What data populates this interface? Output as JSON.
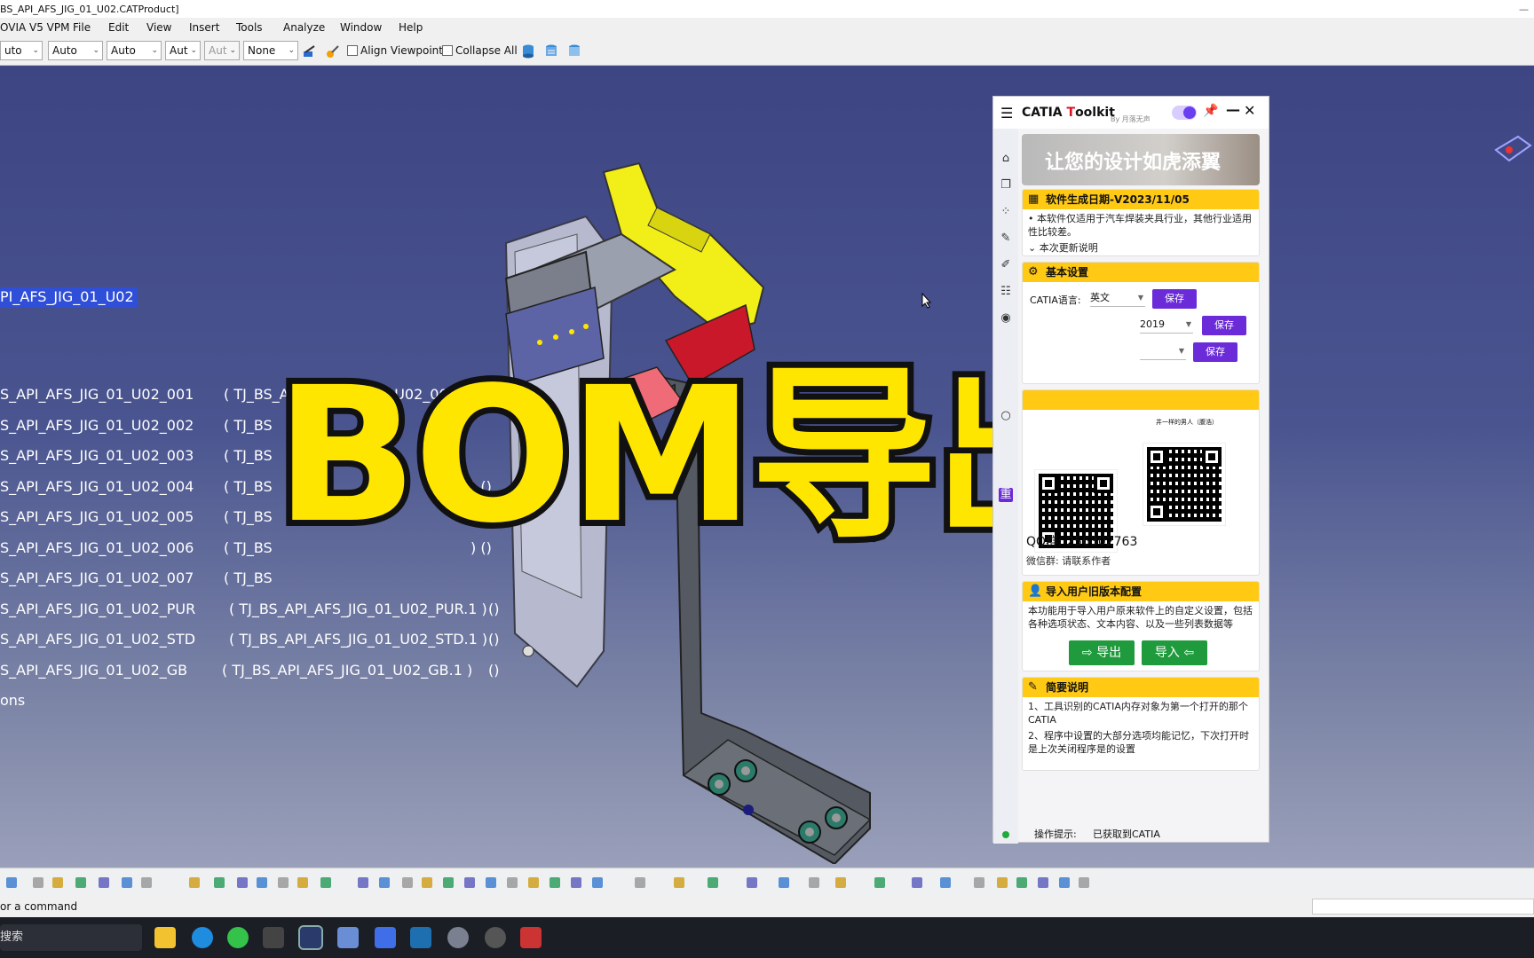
{
  "window": {
    "title": "BS_API_AFS_JIG_01_U02.CATProduct]"
  },
  "menu": {
    "app": "OVIA V5 VPM",
    "items": [
      "File",
      "Edit",
      "View",
      "Insert",
      "Tools",
      "Analyze",
      "Window",
      "Help"
    ]
  },
  "toolbar": {
    "combos": [
      "uto",
      "Auto",
      "Auto",
      "Aut",
      "Aut",
      "None"
    ],
    "align_viewpoint": "Align Viewpoint",
    "collapse_all": "Collapse All"
  },
  "tree": {
    "root": "PI_AFS_JIG_01_U02",
    "rows": [
      {
        "name": "S_API_AFS_JIG_01_U02_001",
        "instance": "( TJ_BS_API_AFS_JIG_01_U02_001.1 )",
        "extra": "()"
      },
      {
        "name": "S_API_AFS_JIG_01_U02_002",
        "instance": "( TJ_BS",
        "extra": ""
      },
      {
        "name": "S_API_AFS_JIG_01_U02_003",
        "instance": "( TJ_BS",
        "extra": ""
      },
      {
        "name": "S_API_AFS_JIG_01_U02_004",
        "instance": "( TJ_BS",
        "extra": ")  ()"
      },
      {
        "name": "S_API_AFS_JIG_01_U02_005",
        "instance": "( TJ_BS",
        "extra": ")  ()"
      },
      {
        "name": "S_API_AFS_JIG_01_U02_006",
        "instance": "( TJ_BS",
        "extra": ")  ()"
      },
      {
        "name": "S_API_AFS_JIG_01_U02_007",
        "instance": "( TJ_BS",
        "extra": ""
      },
      {
        "name": "S_API_AFS_JIG_01_U02_PUR",
        "instance": "( TJ_BS_API_AFS_JIG_01_U02_PUR.1 )",
        "extra": "()"
      },
      {
        "name": "S_API_AFS_JIG_01_U02_STD",
        "instance": "( TJ_BS_API_AFS_JIG_01_U02_STD.1 )",
        "extra": "()"
      },
      {
        "name": "S_API_AFS_JIG_01_U02_GB",
        "instance": "( TJ_BS_API_AFS_JIG_01_U02_GB.1 )",
        "extra": "()"
      }
    ],
    "footer": "ons"
  },
  "overlay": {
    "title": "BOM导出"
  },
  "panel": {
    "title_prefix": "CATIA ",
    "title_accent": "T",
    "title_suffix": "oolkit",
    "byline": "By 月落无声",
    "banner": "让您的设计如虎添翼",
    "release": {
      "header": "软件生成日期-V2023/11/05",
      "text": "• 本软件仅适用于汽车焊装夹具行业，其他行业适用性比较差。",
      "update_link": "本次更新说明"
    },
    "settings": {
      "header": "基本设置",
      "language_label": "CATIA语言:",
      "language_value": "英文",
      "version_value": "2019",
      "save_label": "保存"
    },
    "contact": {
      "qq": "QQ群:  256302763",
      "wechat": "微信群:  请联系作者",
      "side_tag": "重",
      "wechat_name": "井一样的男人（腹浩）"
    },
    "import_config": {
      "header": "导入用户旧版本配置",
      "text": "本功能用于导入用户原来软件上的自定义设置，包括各种选项状态、文本内容、以及一些列表数据等",
      "export_label": "导出",
      "import_label": "导入"
    },
    "notes": {
      "header": "简要说明",
      "text1": "1、工具识别的CATIA内存对象为第一个打开的那个CATIA",
      "text2": "2、程序中设置的大部分选项均能记忆，下次打开时是上次关闭程序是的设置"
    },
    "status": {
      "label": "操作提示:",
      "value": "已获取到CATIA"
    }
  },
  "command_bar": {
    "prompt": "or a command"
  },
  "taskbar": {
    "search": "搜索"
  },
  "colors": {
    "accent_yellow": "#ffc914",
    "purple": "#6b2bd9",
    "green": "#1f9a3c",
    "tree_highlight": "#2f4fd8",
    "overlay_text": "#ffe600"
  }
}
